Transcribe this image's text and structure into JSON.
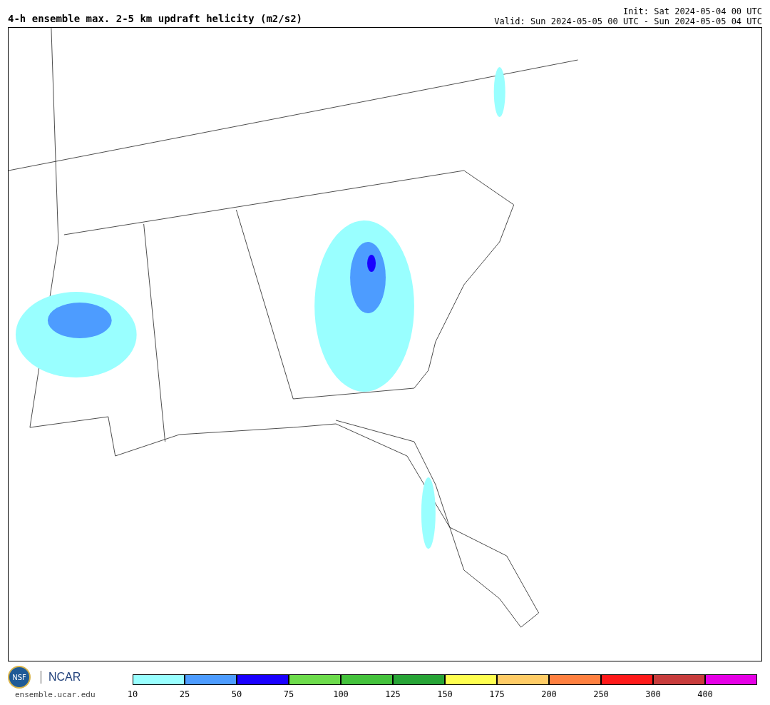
{
  "header": {
    "title": "4-h ensemble max. 2-5 km updraft helicity (m2/s2)",
    "init": "Init: Sat 2024-05-04 00 UTC",
    "valid": "Valid: Sun 2024-05-05 00 UTC - Sun 2024-05-05 04 UTC"
  },
  "footer": {
    "logo_left": "NSF",
    "logo_right": "NCAR",
    "site": "ensemble.ucar.edu"
  },
  "legend": {
    "bins": [
      {
        "label": "10",
        "color": "#99ffff"
      },
      {
        "label": "25",
        "color": "#4d9cff"
      },
      {
        "label": "50",
        "color": "#1a00ff"
      },
      {
        "label": "75",
        "color": "#6ddc4c"
      },
      {
        "label": "100",
        "color": "#44c23c"
      },
      {
        "label": "125",
        "color": "#27a436"
      },
      {
        "label": "150",
        "color": "#ffff50"
      },
      {
        "label": "175",
        "color": "#ffcc66"
      },
      {
        "label": "200",
        "color": "#ff8040"
      },
      {
        "label": "250",
        "color": "#ff1a1a"
      },
      {
        "label": "300",
        "color": "#c83c3c"
      },
      {
        "label": "400",
        "color": "#e600e6"
      }
    ]
  }
}
